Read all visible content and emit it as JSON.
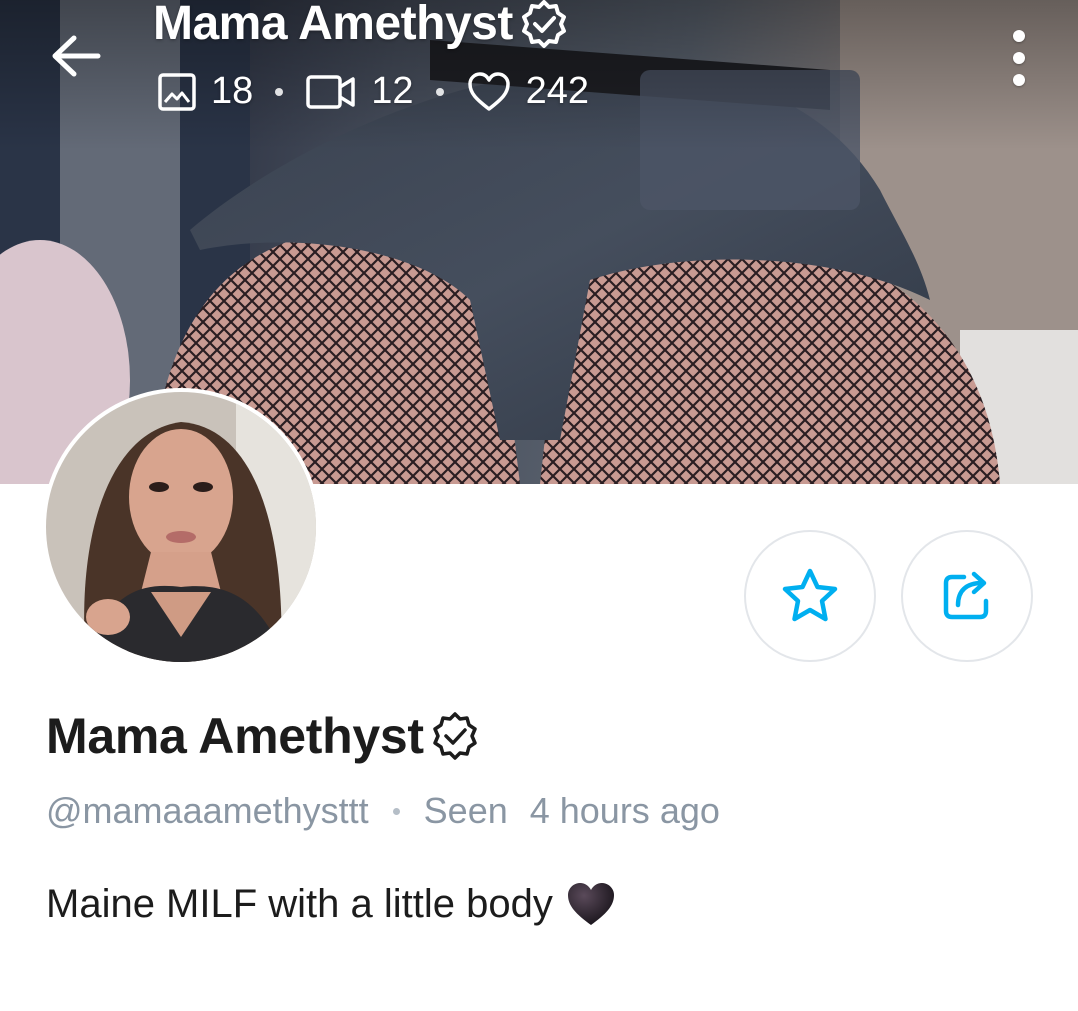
{
  "header": {
    "title": "Mama Amethyst",
    "stats": {
      "photos": "18",
      "videos": "12",
      "likes": "242"
    }
  },
  "profile": {
    "name": "Mama Amethyst",
    "username": "@mamaaamethysttt",
    "seen_label": "Seen",
    "seen_time": "4 hours ago",
    "bio": "Maine MILF with a little body"
  },
  "icons": {
    "back": "arrow-left-icon",
    "verified": "verified-badge-icon",
    "photos": "image-icon",
    "videos": "video-icon",
    "likes": "heart-outline-icon",
    "menu": "more-vertical-icon",
    "favorite": "star-icon",
    "share": "share-icon",
    "bio_emoji": "black-heart-icon"
  },
  "colors": {
    "accent": "#00aff0",
    "text_primary": "#1c1c1c",
    "text_secondary": "#8a96a3",
    "button_border": "#e3e6ea"
  }
}
